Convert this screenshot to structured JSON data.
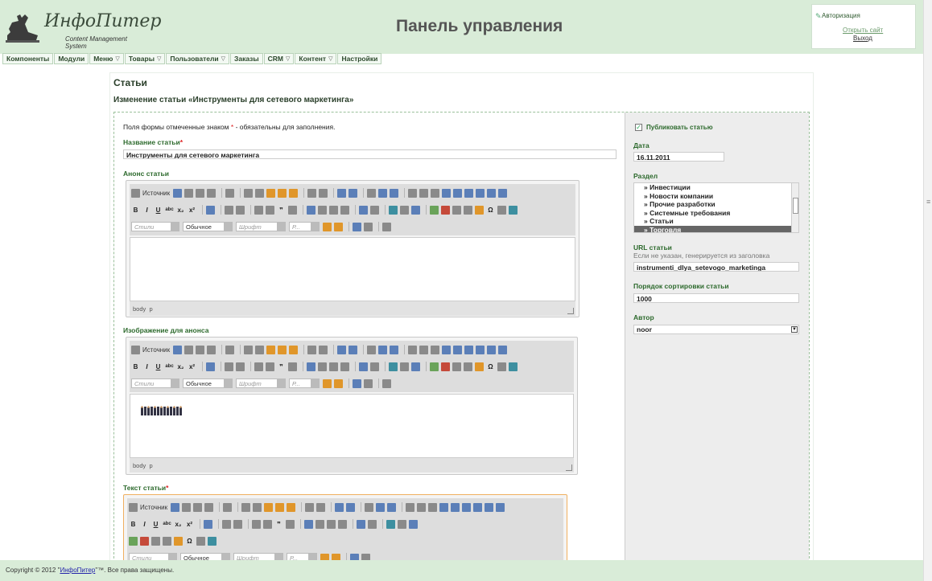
{
  "header": {
    "logo_name": "ИнфоПитер",
    "logo_sub": "Content Management System",
    "title": "Панель управления"
  },
  "auth": {
    "title": "Авторизация",
    "open_site": "Открыть сайт",
    "logout": "Выход"
  },
  "menu": [
    {
      "label": "Компоненты"
    },
    {
      "label": "Модули"
    },
    {
      "label": "Меню"
    },
    {
      "label": "Товары"
    },
    {
      "label": "Пользователи"
    },
    {
      "label": "Заказы"
    },
    {
      "label": "CRM"
    },
    {
      "label": "Контент"
    },
    {
      "label": "Настройки"
    }
  ],
  "page": {
    "title": "Статьи",
    "edit_title": "Изменение статьи «Инструменты для сетевого маркетинга»",
    "note_before": "Поля формы отмеченные знаком",
    "note_star": "*",
    "note_after": "- обязательны для заполнения."
  },
  "form": {
    "name_label": "Название статьи",
    "name_value": "Инструменты для сетевого маркетинга",
    "announce_label": "Анонс статьи",
    "image_label": "Изображение для анонса",
    "text_label": "Текст статьи",
    "required_star": "*"
  },
  "editor": {
    "source": "Источник",
    "styles": "Стили",
    "format": "Обычное",
    "font": "Шрифт",
    "size": "Р...",
    "status_body": "body",
    "status_p": "p"
  },
  "sidebar": {
    "publish_label": "Публиковать статью",
    "publish_checked": true,
    "date_label": "Дата",
    "date_value": "16.11.2011",
    "section_label": "Раздел",
    "sections": [
      "» Инвестиции",
      "» Новости компании",
      "» Прочие разработки",
      "» Системные требования",
      "» Статьи",
      "» Торговля"
    ],
    "selected_section": "» Торговля",
    "url_label": "URL статьи",
    "url_hint": "Если не указан, генерируется из заголовка",
    "url_value": "instrumenti_dlya_setevogo_marketinga",
    "sort_label": "Порядок сортировки статьи",
    "sort_value": "1000",
    "author_label": "Автор",
    "author_value": "noor"
  },
  "footer": {
    "prefix": "Copyright © 2012 \"",
    "link": "ИнфоПитер",
    "suffix": "\"™. Все права защищены."
  },
  "colors": {
    "header_bg": "#d9ecd8",
    "label_green": "#2d6a2d",
    "required_red": "#dd2222"
  }
}
